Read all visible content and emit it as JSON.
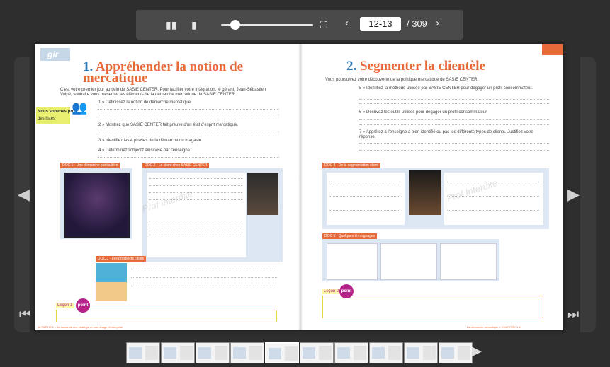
{
  "toolbar": {
    "page_value": "12-13",
    "page_total": "/ 309",
    "prev_label": "‹",
    "next_label": "›",
    "zoom_level": 0.15
  },
  "left_page": {
    "section_logo": "gir",
    "title_num": "1.",
    "title": "Appréhender la notion de mercatique",
    "intro": "C'est votre premier jour au sein de SASIE CENTER. Pour faciliter votre intégration, le gérant, Jean-Sébastien Volpé, souhaite vous présenter les éléments de la démarche mercatique de SASIE CENTER.",
    "brand_sub": "Nous sommes pros",
    "brand_sub2": "des listes",
    "tasks": [
      "1 » Définissez la notion de démarche mercatique.",
      "2 » Montrez que SASIE CENTER fait preuve d'un état d'esprit mercatique.",
      "3 » Identifiez les 4 phases de la démarche du magasin.",
      "4 » Déterminez l'objectif ainsi visé par l'enseigne."
    ],
    "doc1_label": "DOC 1 · Une démarche particulière",
    "doc2_label": "DOC 2 · Le client chez SASIE CENTER",
    "doc3_label": "DOC 3 · Les prospects ciblés",
    "lessons": "Leçon 1",
    "point": "point",
    "footer": "10 PARTIE 1 » Je construis une stratégie et mon image d'entreprise",
    "watermark": "Prof Interdite"
  },
  "right_page": {
    "title_num": "2.",
    "title": "Segmenter la clientèle",
    "intro": "Vous poursuivez votre découverte de la politique mercatique de SASIE CENTER.",
    "tasks": [
      "5 » Identifiez la méthode utilisée par SASIE CENTER pour dégager un profil consommateur.",
      "6 » Décrivez les outils utilisés pour dégager un profil consommateur.",
      "7 » Apprêtez à l'enseigne a bien identifié ou pas les différents types de clients. Justifiez votre réponse."
    ],
    "doc4_label": "DOC 4 · De la segmentation client",
    "doc5_label": "DOC 5 · Quelques témoignages",
    "lessons": "Leçon 2",
    "point": "point",
    "footer": "La démarche mercatique » CHAPITRE 1 11",
    "watermark": "Prof Interdite"
  },
  "nav": {
    "left_arrow": "◀",
    "right_arrow": "▶",
    "first_arrow": "⏮",
    "last_arrow": "⏭"
  },
  "thumbnails": {
    "count": 10,
    "selected_index": 4,
    "next_label": "▶"
  }
}
